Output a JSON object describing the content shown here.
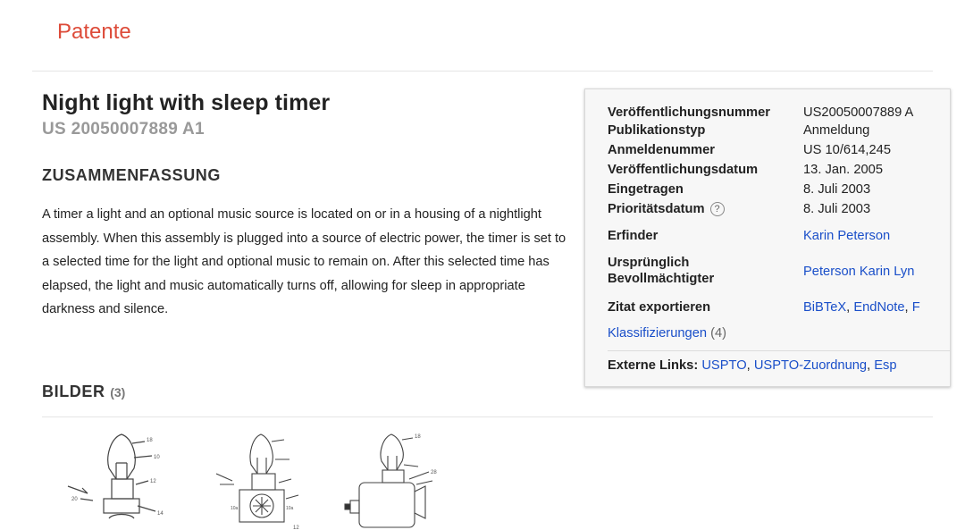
{
  "header": {
    "logo": "Patente"
  },
  "patent": {
    "title": "Night light with sleep timer",
    "number": "US 20050007889 A1"
  },
  "summary": {
    "heading": "ZUSAMMENFASSUNG",
    "text": "A timer a light and an optional music source is located on or in a housing of a nightlight assembly. When this assembly is plugged into a source of electric power, the timer is set to a selected time for the light and optional music to remain on. After this selected time has elapsed, the light and music automatically turns off, allowing for sleep in appropriate darkness and silence."
  },
  "images": {
    "heading": "BILDER",
    "count": "(3)"
  },
  "meta": {
    "rows": [
      {
        "label": "Veröffentlichungsnummer",
        "value": "US20050007889 A"
      },
      {
        "label": "Publikationstyp",
        "value": "Anmeldung"
      },
      {
        "label": "Anmeldenummer",
        "value": "US 10/614,245"
      },
      {
        "label": "Veröffentlichungsdatum",
        "value": "13. Jan. 2005"
      },
      {
        "label": "Eingetragen",
        "value": "8. Juli 2003"
      },
      {
        "label": "Prioritätsdatum",
        "value": "8. Juli 2003"
      }
    ],
    "priority_help": "?",
    "inventor_label": "Erfinder",
    "inventor": "Karin Peterson",
    "assignee_label_1": "Ursprünglich",
    "assignee_label_2": "Bevollmächtigter",
    "assignee": "Peterson Karin Lyn",
    "export_label": "Zitat exportieren",
    "export_bibtex": "BiBTeX",
    "export_sep1": ", ",
    "export_endnote": "EndNote",
    "export_sep2": ", ",
    "export_more": "F",
    "classifications": "Klassifizierungen",
    "classifications_count": "(4)",
    "external_label": "Externe Links:",
    "external_uspto": "USPTO",
    "external_sep1": ", ",
    "external_assign": "USPTO-Zuordnung",
    "external_sep2": ", ",
    "external_esp": "Esp"
  },
  "colors": {
    "logo": "#dd4b39",
    "link": "#1a4fc9"
  }
}
